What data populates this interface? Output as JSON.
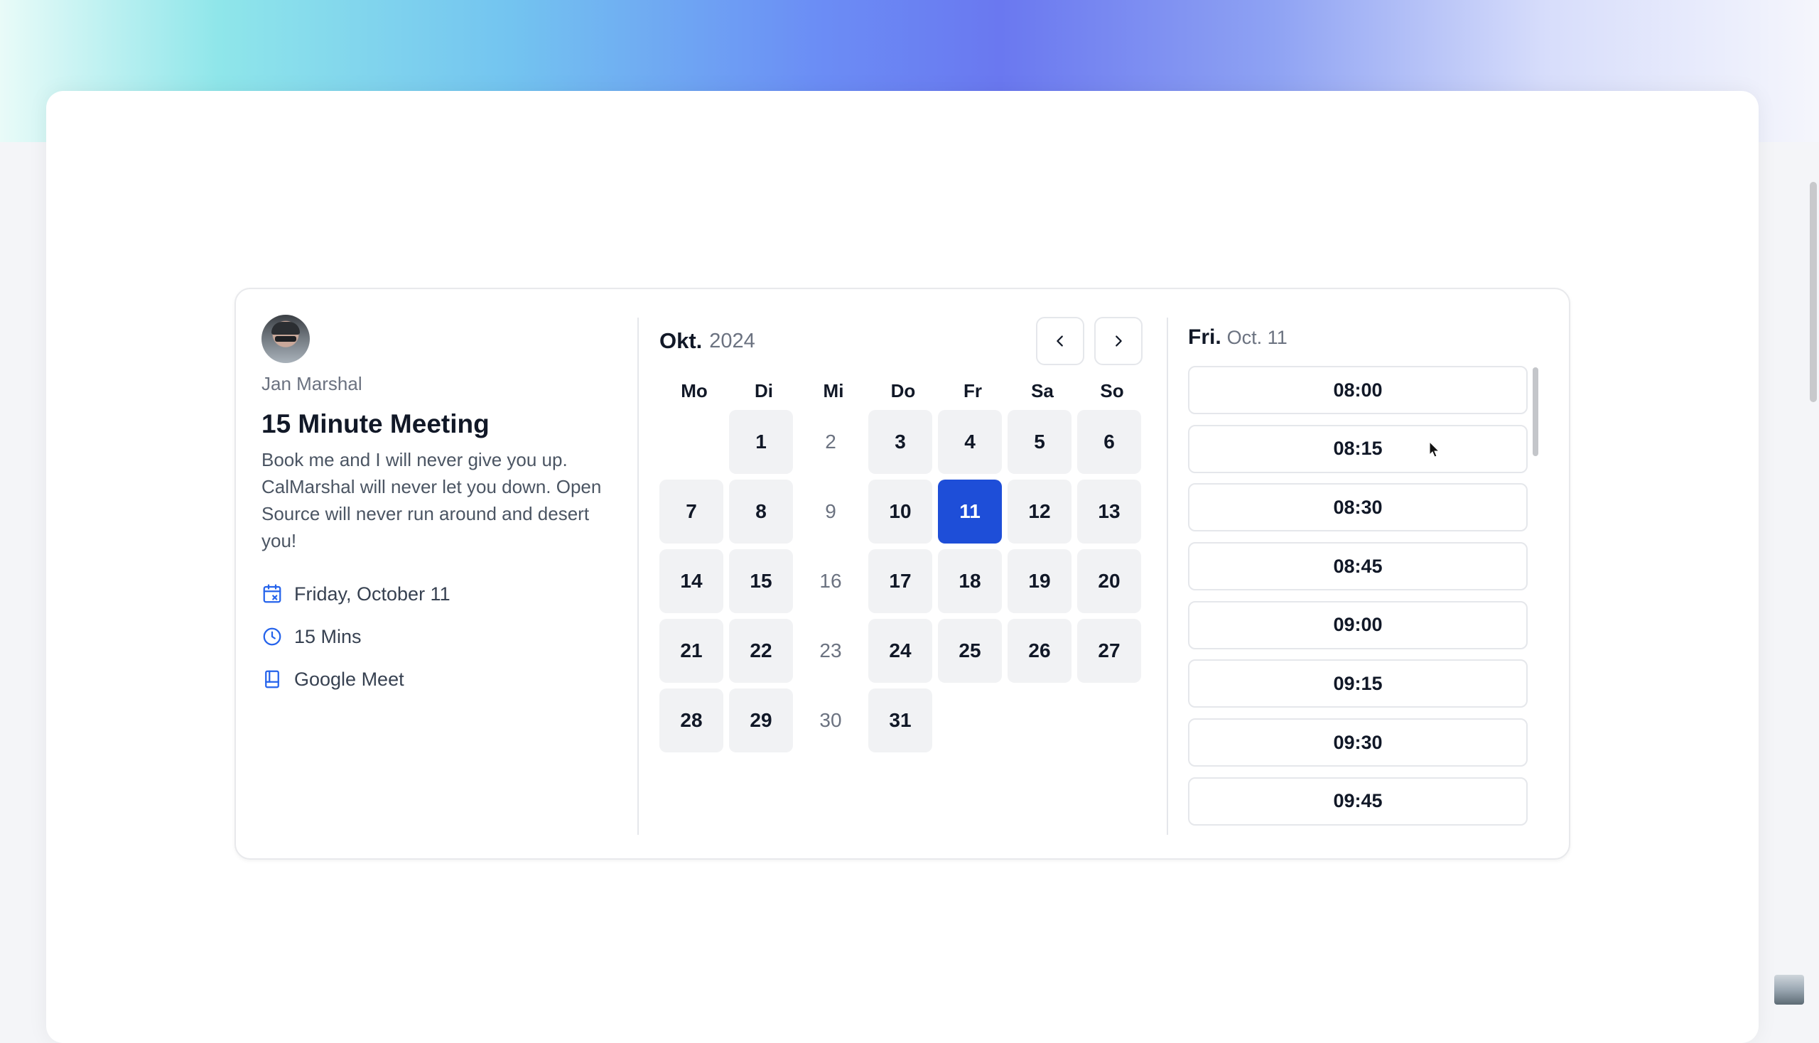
{
  "host": {
    "name": "Jan Marshal"
  },
  "event": {
    "title": "15 Minute Meeting",
    "description": "Book me and I will never give you up. CalMarshal will never let you down. Open Source will never run around and desert you!",
    "date": "Friday, October 11",
    "duration": "15 Mins",
    "location": "Google Meet"
  },
  "calendar": {
    "month": "Okt.",
    "year": "2024",
    "weekdays": [
      "Mo",
      "Di",
      "Mi",
      "Do",
      "Fr",
      "Sa",
      "So"
    ],
    "days": [
      {
        "label": "",
        "state": "empty"
      },
      {
        "label": "1",
        "state": "available"
      },
      {
        "label": "2",
        "state": "unavailable"
      },
      {
        "label": "3",
        "state": "available"
      },
      {
        "label": "4",
        "state": "available"
      },
      {
        "label": "5",
        "state": "available"
      },
      {
        "label": "6",
        "state": "available"
      },
      {
        "label": "7",
        "state": "available"
      },
      {
        "label": "8",
        "state": "available"
      },
      {
        "label": "9",
        "state": "unavailable"
      },
      {
        "label": "10",
        "state": "available"
      },
      {
        "label": "11",
        "state": "selected"
      },
      {
        "label": "12",
        "state": "available"
      },
      {
        "label": "13",
        "state": "available"
      },
      {
        "label": "14",
        "state": "available"
      },
      {
        "label": "15",
        "state": "available"
      },
      {
        "label": "16",
        "state": "unavailable"
      },
      {
        "label": "17",
        "state": "available"
      },
      {
        "label": "18",
        "state": "available"
      },
      {
        "label": "19",
        "state": "available"
      },
      {
        "label": "20",
        "state": "available"
      },
      {
        "label": "21",
        "state": "available"
      },
      {
        "label": "22",
        "state": "available"
      },
      {
        "label": "23",
        "state": "unavailable"
      },
      {
        "label": "24",
        "state": "available"
      },
      {
        "label": "25",
        "state": "available"
      },
      {
        "label": "26",
        "state": "available"
      },
      {
        "label": "27",
        "state": "available"
      },
      {
        "label": "28",
        "state": "available"
      },
      {
        "label": "29",
        "state": "available"
      },
      {
        "label": "30",
        "state": "unavailable"
      },
      {
        "label": "31",
        "state": "available"
      }
    ]
  },
  "slots": {
    "day_of_week": "Fri.",
    "date": "Oct. 11",
    "times": [
      "08:00",
      "08:15",
      "08:30",
      "08:45",
      "09:00",
      "09:15",
      "09:30",
      "09:45"
    ]
  },
  "colors": {
    "accent": "#1e4ed8",
    "available_bg": "#f1f2f4"
  },
  "icons": {
    "date": "calendar-icon",
    "duration": "clock-icon",
    "location": "video-meeting-icon",
    "prev": "chevron-left-icon",
    "next": "chevron-right-icon"
  }
}
